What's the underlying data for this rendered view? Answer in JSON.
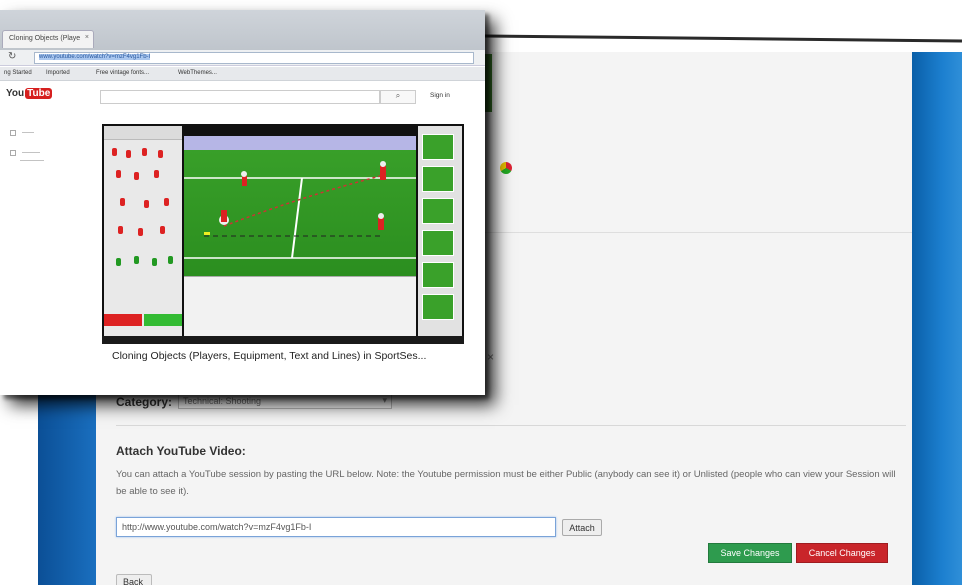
{
  "browser": {
    "tab_title": "Cloning Objects (Playe",
    "tab_close": "×",
    "reload_icon": "↻",
    "url": "www.youtube.com/watch?v=mzF4vg1Fb-I",
    "bookmarks": [
      "ng Started",
      "Imported",
      "Free vintage fonts...",
      "WebThemes..."
    ]
  },
  "youtube": {
    "logo_text": "You",
    "logo_tube": "Tube",
    "search_icon": "⌕",
    "sign_in": "Sign in",
    "video_title": "Cloning Objects (Players, Equipment, Text and Lines) in SportSes..."
  },
  "form": {
    "category_label": "Category:",
    "category_value": "Technical: Shooting",
    "chevron": "▾",
    "attach_heading": "Attach YouTube Video:",
    "attach_description": "You can attach a YouTube session by pasting the URL below. Note: the Youtube permission must be either Public (anybody can see it) or Unlisted (people who can view your Session will be able to see it).",
    "url_value": "http://www.youtube.com/watch?v=mzF4vg1Fb-I",
    "attach_button": "Attach",
    "save_button": "Save Changes",
    "cancel_button": "Cancel Changes",
    "back_button": "Back"
  },
  "colors": {
    "save": "#2e9b4e",
    "cancel": "#c9252a",
    "accent_blue": "#1c7fcf"
  }
}
